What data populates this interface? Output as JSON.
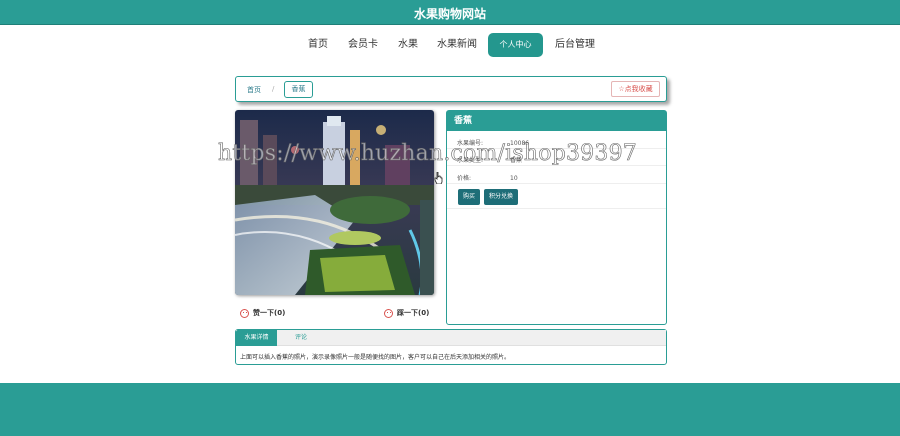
{
  "header": {
    "title": "水果购物网站"
  },
  "nav": {
    "items": [
      {
        "label": "首页",
        "active": false
      },
      {
        "label": "会员卡",
        "active": false
      },
      {
        "label": "水果",
        "active": false
      },
      {
        "label": "水果新闻",
        "active": false
      },
      {
        "label": "个人中心",
        "active": true
      },
      {
        "label": "后台管理",
        "active": false
      }
    ]
  },
  "breadcrumb": {
    "home": "首页",
    "separator": "/",
    "current": "香蕉",
    "favorite": "☆点我收藏"
  },
  "product": {
    "title": "香蕉",
    "fields": [
      {
        "label": "水果编号:",
        "value": "10086"
      },
      {
        "label": "水果类型:",
        "value": "香蕉"
      },
      {
        "label": "价格:",
        "value": "10"
      }
    ],
    "buy_label": "购买",
    "points_label": "积分兑换"
  },
  "votes": {
    "up": "赞一下(0)",
    "down": "踩一下(0)"
  },
  "tabs": {
    "items": [
      {
        "label": "水果详情",
        "active": true
      },
      {
        "label": "评论",
        "active": false
      }
    ],
    "content": "上面可以插入香蕉的照片，演示录像照片一般是随便找的图片，客户可以自己在后天添加相关的照片。"
  },
  "watermark": "https://www.huzhan.com/ishop39397",
  "colors": {
    "accent": "#2a9d95",
    "button": "#1e6e78",
    "favorite": "#d9534f"
  }
}
